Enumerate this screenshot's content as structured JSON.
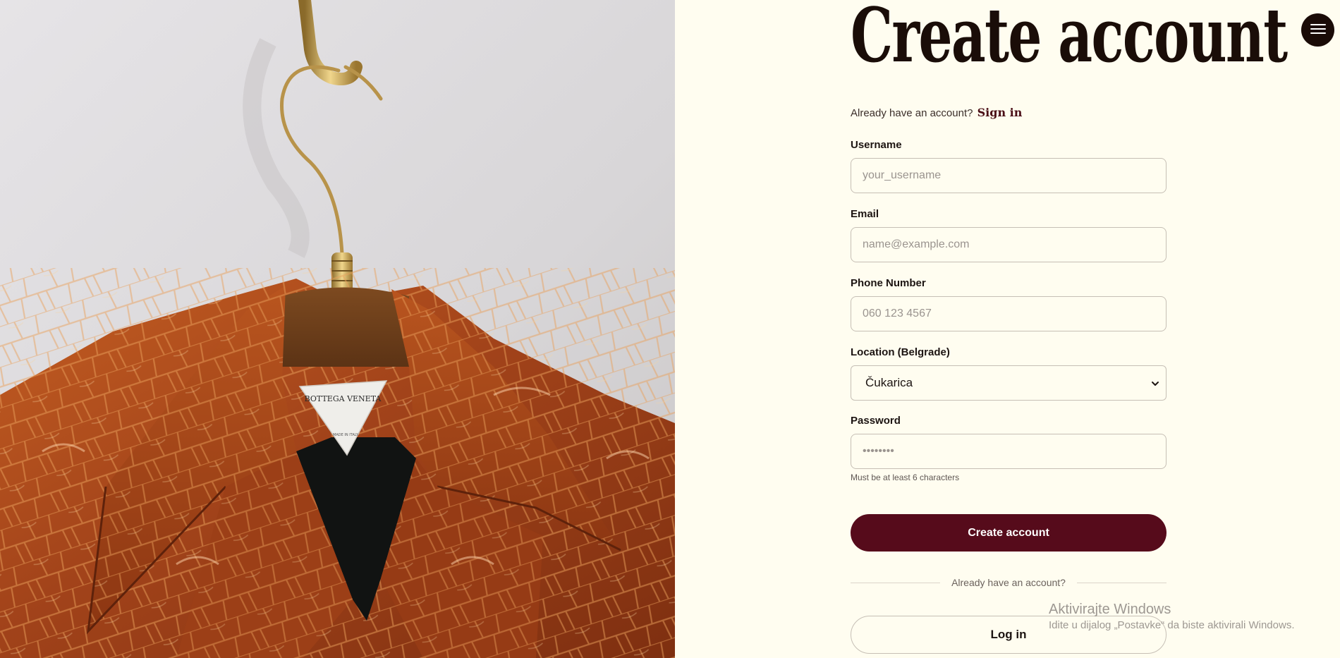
{
  "hero": {
    "label_brand": "BOTTEGA VENETA",
    "label_origin": "MADE IN ITALY"
  },
  "form": {
    "title": "Create account",
    "signin_prompt": "Already have an account?",
    "signin_link": "Sign in",
    "username": {
      "label": "Username",
      "placeholder": "your_username",
      "value": ""
    },
    "email": {
      "label": "Email",
      "placeholder": "name@example.com",
      "value": ""
    },
    "phone": {
      "label": "Phone Number",
      "placeholder": "060 123 4567",
      "value": ""
    },
    "location": {
      "label": "Location (Belgrade)",
      "selected": "Čukarica"
    },
    "password": {
      "label": "Password",
      "placeholder": "••••••••",
      "value": "",
      "hint": "Must be at least 6 characters"
    },
    "submit_label": "Create account",
    "divider_text": "Already have an account?",
    "login_label": "Log in"
  },
  "menu": {
    "icon": "hamburger-icon"
  },
  "watermark": {
    "title": "Aktivirajte Windows",
    "subtitle": "Idite u dijalog „Postavke“ da biste aktivirali Windows."
  },
  "colors": {
    "background": "#fffdf0",
    "primary": "#560b1b",
    "menu_button": "#1a0b07",
    "leather": "#a8481a"
  }
}
